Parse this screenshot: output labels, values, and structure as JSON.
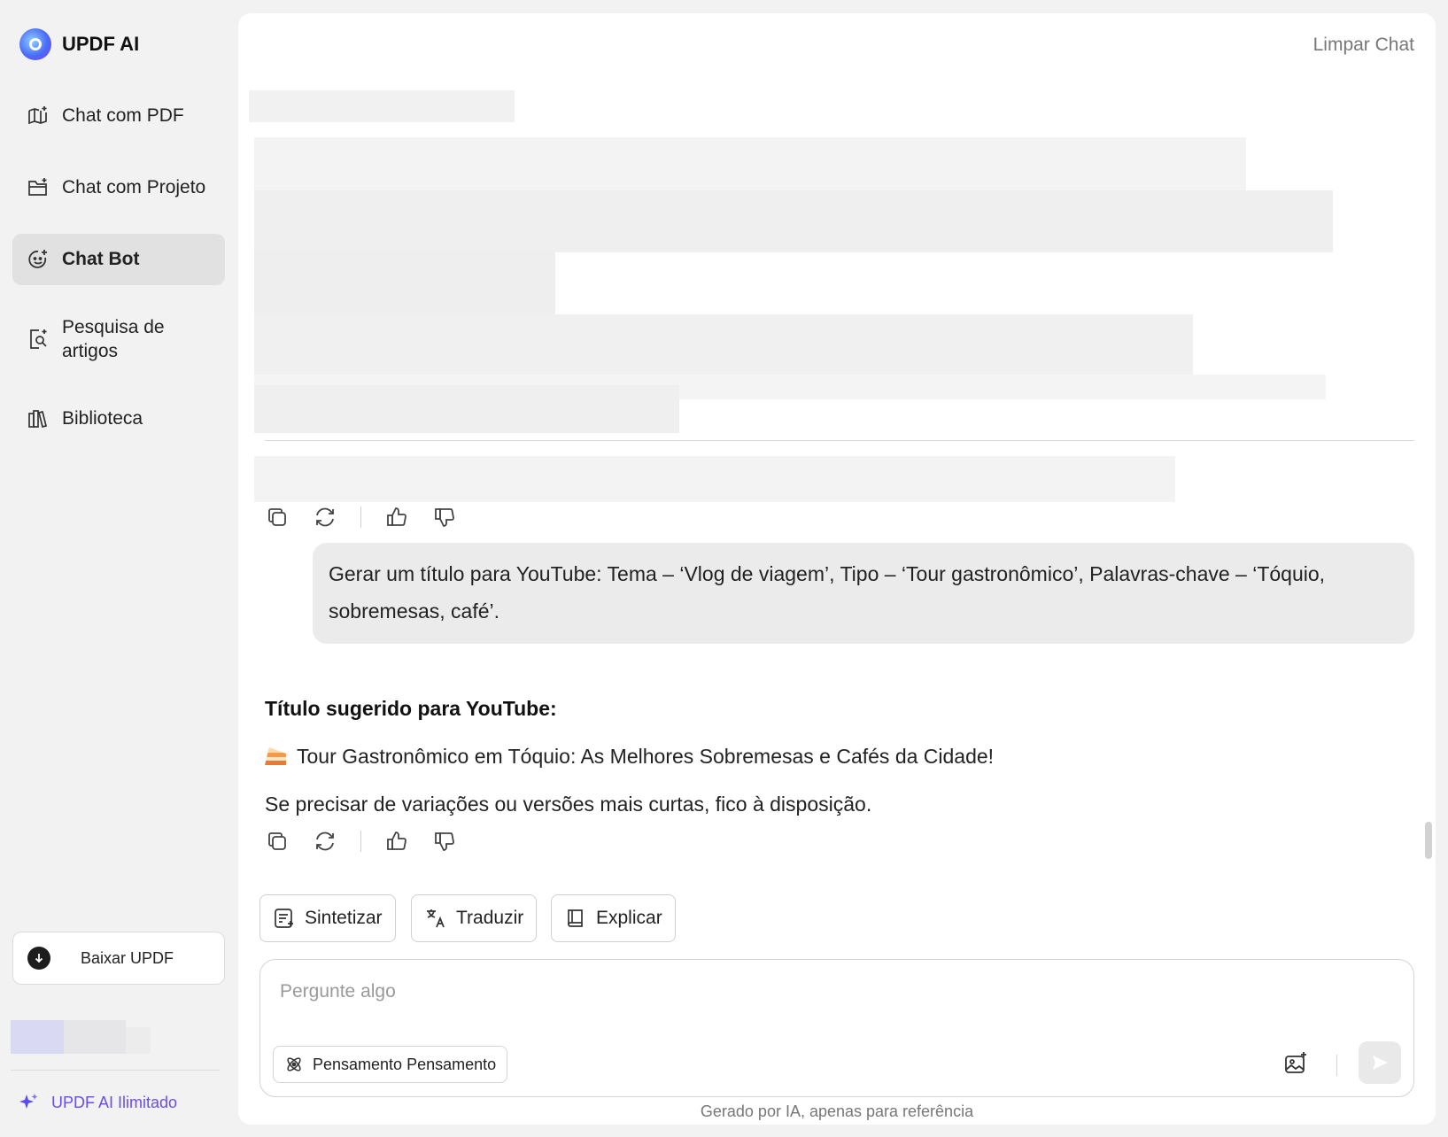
{
  "brand": {
    "name": "UPDF AI"
  },
  "sidebar": {
    "items": [
      {
        "label": "Chat com PDF",
        "icon": "book-sparkle-icon"
      },
      {
        "label": "Chat com Projeto",
        "icon": "folder-sparkle-icon"
      },
      {
        "label": "Chat Bot",
        "icon": "bot-face-icon",
        "active": true
      },
      {
        "label": "Pesquisa de artigos",
        "icon": "doc-search-icon"
      },
      {
        "label": "Biblioteca",
        "icon": "library-icon"
      }
    ],
    "download_label": "Baixar UPDF",
    "unlimited_label": "UPDF AI Ilimitado"
  },
  "header": {
    "clear_chat": "Limpar Chat"
  },
  "conversation": {
    "user_prompt": "Gerar um título para YouTube: Tema – ‘Vlog de viagem’, Tipo – ‘Tour gastronômico’, Palavras-chave – ‘Tóquio, sobremesas, café’.",
    "reply_title": "Título sugerido para YouTube:",
    "reply_suggestion": "Tour Gastronômico em Tóquio: As Melhores Sobremesas e Cafés da Cidade!",
    "reply_followup": "Se precisar de variações ou versões mais curtas, fico à disposição."
  },
  "quick_actions": [
    "Sintetizar",
    "Traduzir",
    "Explicar"
  ],
  "composer": {
    "placeholder": "Pergunte algo",
    "thinking_label": "Pensamento Pensamento"
  },
  "footnote": "Gerado por IA, apenas para referência",
  "colors": {
    "accent": "#6a4cf0",
    "active_nav": "#e1e1e1",
    "bubble": "#ebebeb"
  }
}
